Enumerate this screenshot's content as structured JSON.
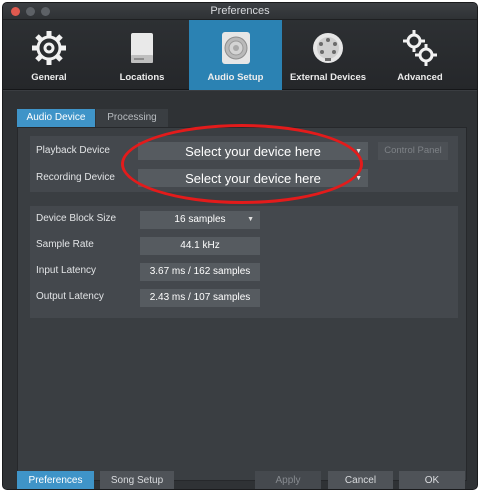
{
  "window": {
    "title": "Preferences"
  },
  "toolbar": {
    "items": [
      {
        "label": "General",
        "icon": "gear-icon"
      },
      {
        "label": "Locations",
        "icon": "drive-icon"
      },
      {
        "label": "Audio Setup",
        "icon": "speaker-icon",
        "active": true
      },
      {
        "label": "External Devices",
        "icon": "midi-port-icon"
      },
      {
        "label": "Advanced",
        "icon": "gears-icon"
      }
    ]
  },
  "tabs": [
    {
      "label": "Audio Device",
      "active": true
    },
    {
      "label": "Processing",
      "active": false
    }
  ],
  "devices": {
    "playback_label": "Playback Device",
    "playback_value": "Select your device here",
    "recording_label": "Recording Device",
    "recording_value": "Select your device here",
    "control_panel_label": "Control Panel"
  },
  "settings": {
    "block_size_label": "Device Block Size",
    "block_size_value": "16 samples",
    "sample_rate_label": "Sample Rate",
    "sample_rate_value": "44.1 kHz",
    "input_latency_label": "Input Latency",
    "input_latency_value": "3.67 ms / 162 samples",
    "output_latency_label": "Output Latency",
    "output_latency_value": "2.43 ms / 107 samples"
  },
  "footer": {
    "preferences_label": "Preferences",
    "song_setup_label": "Song Setup",
    "apply_label": "Apply",
    "cancel_label": "Cancel",
    "ok_label": "OK"
  },
  "colors": {
    "accent": "#3f94c8",
    "highlight_ellipse": "#e31b1b"
  }
}
